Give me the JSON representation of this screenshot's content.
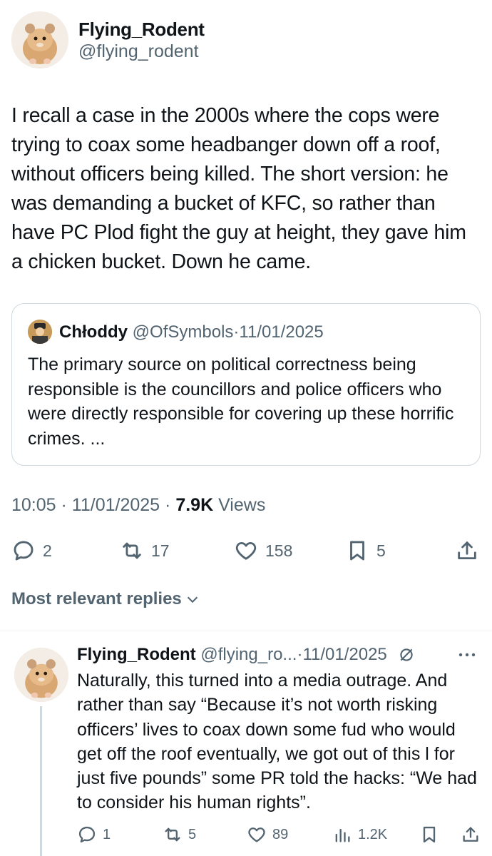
{
  "tweet": {
    "author_name": "Flying_Rodent",
    "author_handle": "@flying_rodent",
    "text": "I recall a case in the 2000s where the cops were trying to coax some headbanger down off a roof, without officers being killed. The short version: he was demanding a bucket of KFC, so rather than have PC Plod fight the guy at height, they gave him a chicken bucket. Down he came.",
    "time": "10:05",
    "date": "11/01/2025",
    "separator": "·",
    "views_count": "7.9K",
    "views_label": "Views"
  },
  "quote": {
    "name": "Chłoddy",
    "handle": "@OfSymbols",
    "separator": "·",
    "date": "11/01/2025",
    "text": "The primary source on political correctness being responsible is the councillors and police officers who were directly responsible for covering up these horrific crimes. ..."
  },
  "actions": {
    "replies": "2",
    "reposts": "17",
    "likes": "158",
    "bookmarks": "5"
  },
  "replies_section": {
    "label": "Most relevant replies"
  },
  "reply": {
    "name": "Flying_Rodent",
    "handle": "@flying_ro...",
    "separator": "·",
    "date": "11/01/2025",
    "text": "Naturally, this turned into a media outrage. And rather than say “Because it’s not worth risking officers’ lives to coax down some fud who would get off the roof eventually, we got out of this l for just five pounds” some PR told the hacks: “We had to consider his human rights”.",
    "replies": "1",
    "reposts": "5",
    "likes": "89",
    "views": "1.2K"
  },
  "icons": {
    "reply": "speech-bubble-icon",
    "repost": "repost-arrows-icon",
    "like": "heart-icon",
    "bookmark": "bookmark-icon",
    "share": "share-upload-icon",
    "views": "bar-chart-icon",
    "edit": "edit-circle-slash-icon",
    "more": "more-dots-icon",
    "expand": "chevron-down-icon"
  },
  "colors": {
    "text_primary": "#0f1419",
    "text_secondary": "#536471",
    "border": "#cfd9de"
  }
}
